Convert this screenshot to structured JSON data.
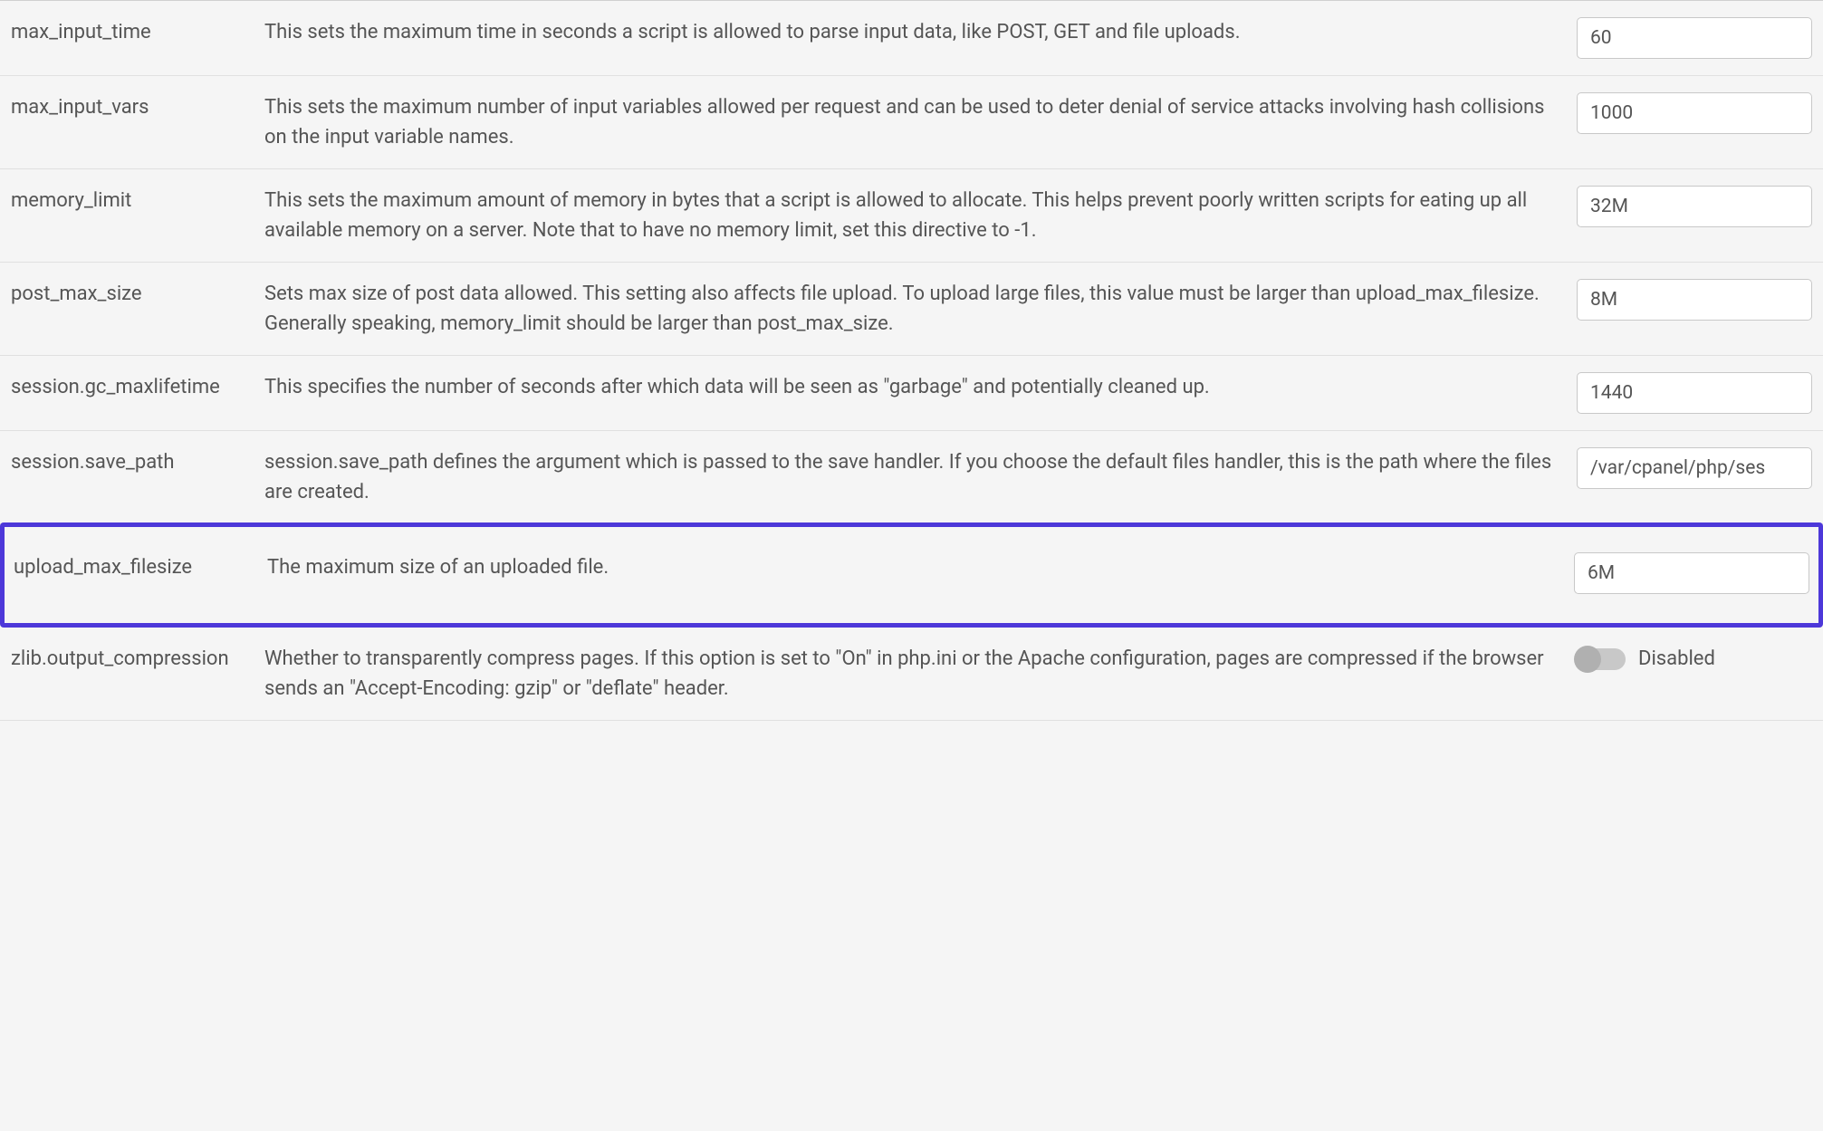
{
  "settings": [
    {
      "name": "max_input_time",
      "desc": "This sets the maximum time in seconds a script is allowed to parse input data, like POST, GET and file uploads.",
      "value": "60",
      "control": "text",
      "highlight": false
    },
    {
      "name": "max_input_vars",
      "desc": "This sets the maximum number of input variables allowed per request and can be used to deter denial of service attacks involving hash collisions on the input variable names.",
      "value": "1000",
      "control": "text",
      "highlight": false
    },
    {
      "name": "memory_limit",
      "desc": "This sets the maximum amount of memory in bytes that a script is allowed to allocate. This helps prevent poorly written scripts for eating up all available memory on a server. Note that to have no memory limit, set this directive to -1.",
      "value": "32M",
      "control": "text",
      "highlight": false
    },
    {
      "name": "post_max_size",
      "desc": "Sets max size of post data allowed. This setting also affects file upload. To upload large files, this value must be larger than upload_max_filesize. Generally speaking, memory_limit should be larger than post_max_size.",
      "value": "8M",
      "control": "text",
      "highlight": false
    },
    {
      "name": "session.gc_maxlifetime",
      "desc": "This specifies the number of seconds after which data will be seen as \"garbage\" and potentially cleaned up.",
      "value": "1440",
      "control": "text",
      "highlight": false
    },
    {
      "name": "session.save_path",
      "desc": "session.save_path defines the argument which is passed to the save handler. If you choose the default files handler, this is the path where the files are created.",
      "value": "/var/cpanel/php/ses",
      "control": "text",
      "highlight": false
    },
    {
      "name": "upload_max_filesize",
      "desc": "The maximum size of an uploaded file.",
      "value": "6M",
      "control": "text",
      "highlight": true
    },
    {
      "name": "zlib.output_compression",
      "desc": "Whether to transparently compress pages. If this option is set to \"On\" in php.ini or the Apache configuration, pages are compressed if the browser sends an \"Accept-Encoding: gzip\" or \"deflate\" header.",
      "value": "Disabled",
      "control": "toggle",
      "toggle_state": false,
      "highlight": false
    }
  ]
}
